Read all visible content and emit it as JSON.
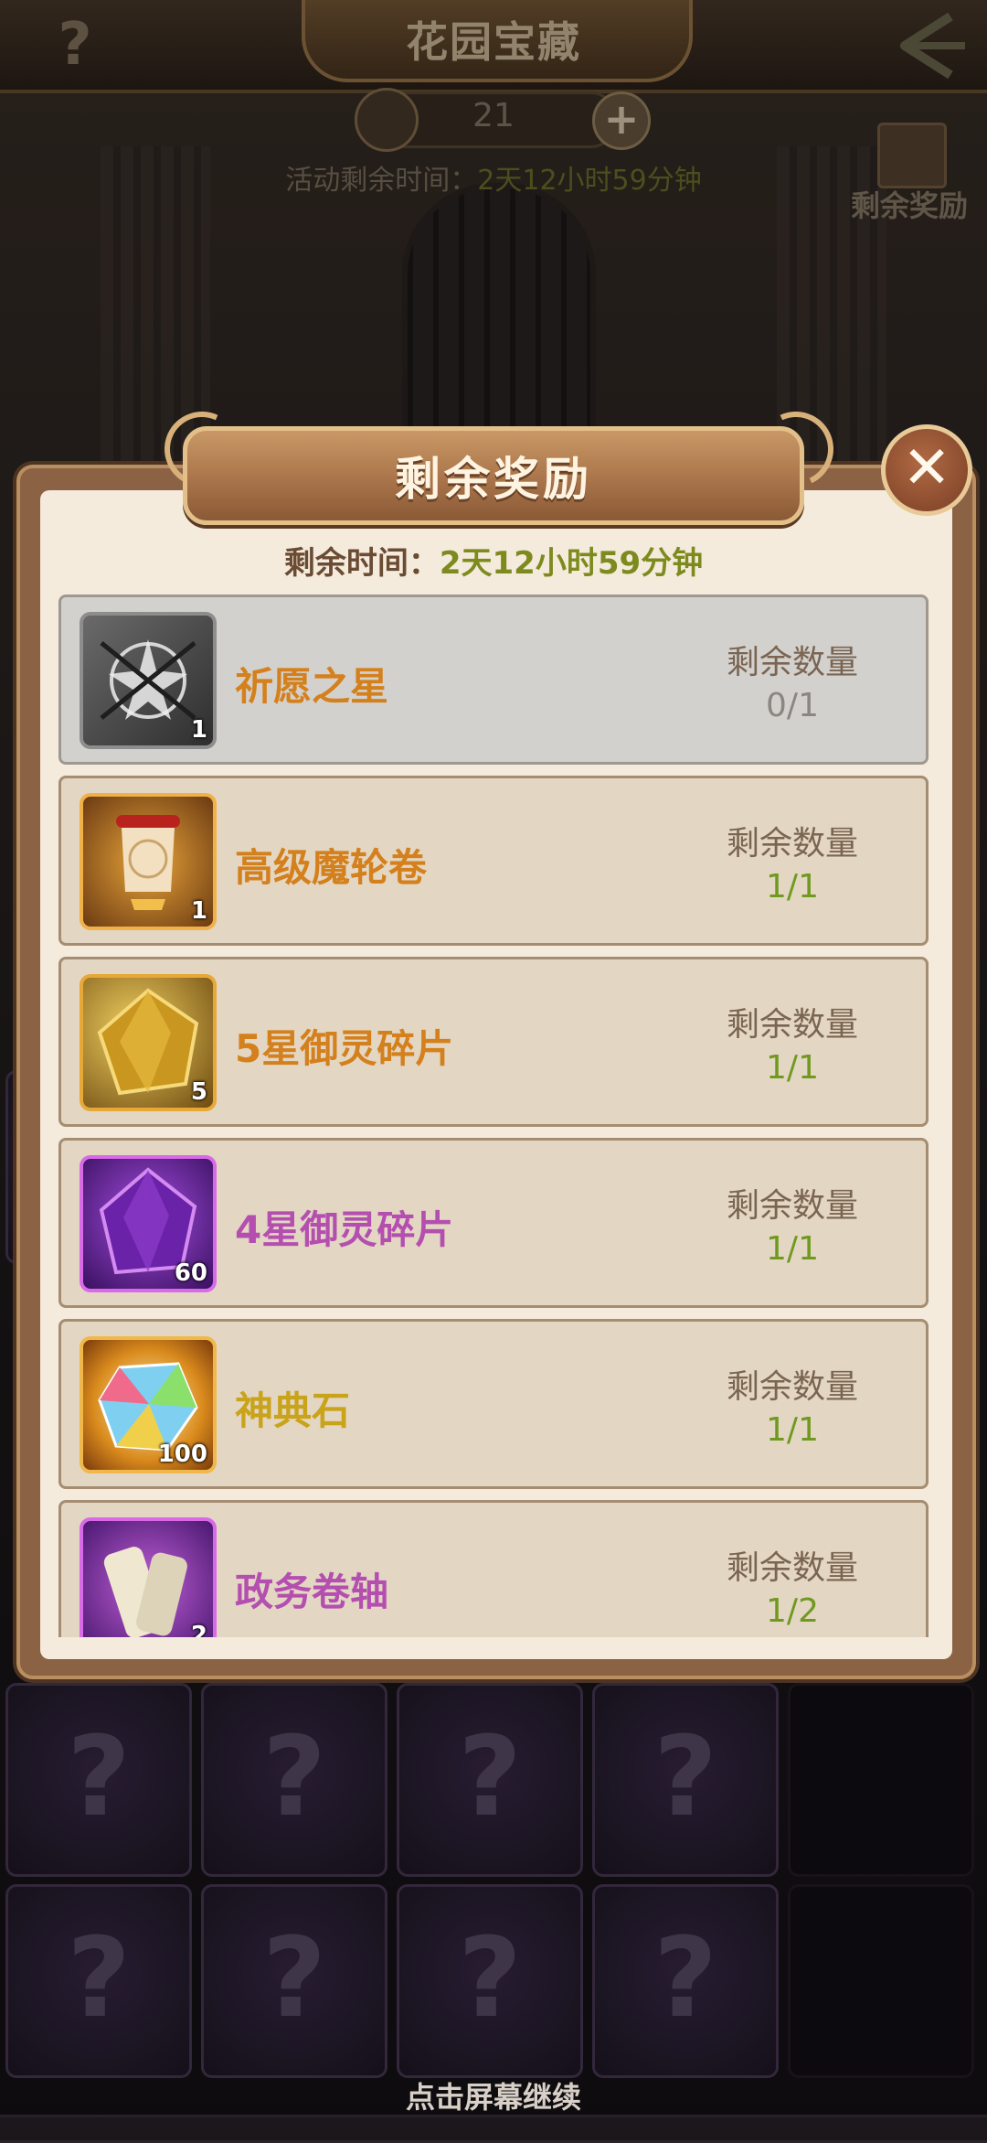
{
  "header": {
    "title": "花园宝藏",
    "help_label": "?",
    "key_count": "21",
    "plus_label": "+",
    "event_time_label": "活动剩余时间：",
    "event_time_value": "2天12小时59分钟",
    "gift_label": "剩余奖励"
  },
  "modal": {
    "title": "剩余奖励",
    "close_label": "✕",
    "time_label": "剩余时间：",
    "time_value": "2天12小时59分钟",
    "remaining_label": "剩余数量",
    "items": [
      {
        "name": "祈愿之星",
        "qty": "1",
        "remaining": "0/1",
        "name_color": "#d4801c",
        "value_color": "#8c8680",
        "icon": "wish-star-icon",
        "claimed": true
      },
      {
        "name": "高级魔轮卷",
        "qty": "1",
        "remaining": "1/1",
        "name_color": "#d4801c",
        "value_color": "#6f9a1f",
        "icon": "magic-scroll-icon",
        "claimed": false
      },
      {
        "name": "5星御灵碎片",
        "qty": "5",
        "remaining": "1/1",
        "name_color": "#d4801c",
        "value_color": "#6f9a1f",
        "icon": "gold-shard-icon",
        "claimed": false
      },
      {
        "name": "4星御灵碎片",
        "qty": "60",
        "remaining": "1/1",
        "name_color": "#b44fb0",
        "value_color": "#6f9a1f",
        "icon": "purple-shard-icon",
        "claimed": false
      },
      {
        "name": "神典石",
        "qty": "100",
        "remaining": "1/1",
        "name_color": "#c9a319",
        "value_color": "#6f9a1f",
        "icon": "rainbow-gem-icon",
        "claimed": false
      },
      {
        "name": "政务卷轴",
        "qty": "2",
        "remaining": "1/2",
        "name_color": "#b44fb0",
        "value_color": "#6f9a1f",
        "icon": "paper-scroll-icon",
        "claimed": false
      }
    ]
  },
  "board": {
    "cell_symbol": "?"
  },
  "footer": {
    "continue_hint": "点击屏幕继续"
  }
}
